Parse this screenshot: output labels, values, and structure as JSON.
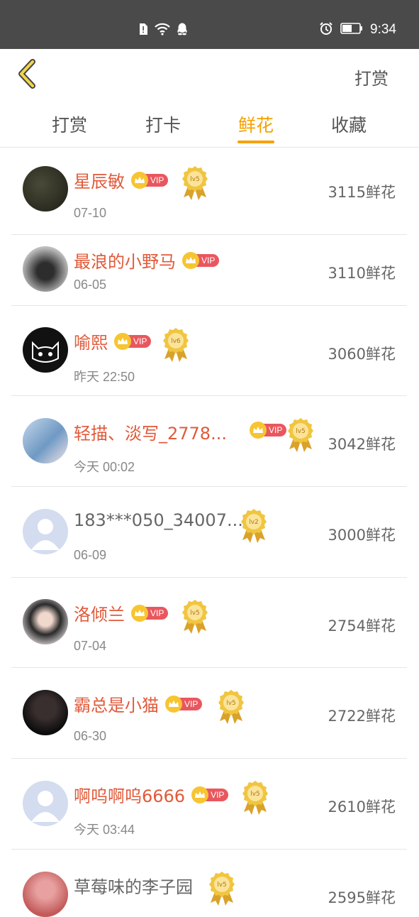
{
  "status_bar": {
    "time": "9:34"
  },
  "header": {
    "right_label": "打赏"
  },
  "tabs": [
    {
      "label": "打赏",
      "active": false
    },
    {
      "label": "打卡",
      "active": false
    },
    {
      "label": "鲜花",
      "active": true
    },
    {
      "label": "收藏",
      "active": false
    }
  ],
  "vip_label": "VIP",
  "rows": [
    {
      "name": "星辰敏",
      "vip": true,
      "level": "lv5",
      "date": "07-10",
      "count": "3115鲜花"
    },
    {
      "name": "最浪的小野马",
      "vip": true,
      "level": "",
      "date": "06-05",
      "count": "3110鲜花"
    },
    {
      "name": "喻熙",
      "vip": true,
      "level": "lv6",
      "date": "昨天 22:50",
      "count": "3060鲜花"
    },
    {
      "name": "轻描、淡写_2778...",
      "vip": true,
      "level": "lv5",
      "date": "今天 00:02",
      "count": "3042鲜花"
    },
    {
      "name": "183***050_34007...",
      "vip": false,
      "level": "lv2",
      "date": "06-09",
      "count": "3000鲜花"
    },
    {
      "name": "洛倾兰",
      "vip": true,
      "level": "lv5",
      "date": "07-04",
      "count": "2754鲜花"
    },
    {
      "name": "霸总是小猫",
      "vip": true,
      "level": "lv5",
      "date": "06-30",
      "count": "2722鲜花"
    },
    {
      "name": "啊呜啊呜6666",
      "vip": true,
      "level": "lv5",
      "date": "今天 03:44",
      "count": "2610鲜花"
    },
    {
      "name": "草莓味的李子园",
      "vip": false,
      "level": "lv5",
      "date": "",
      "count": "2595鲜花"
    }
  ]
}
